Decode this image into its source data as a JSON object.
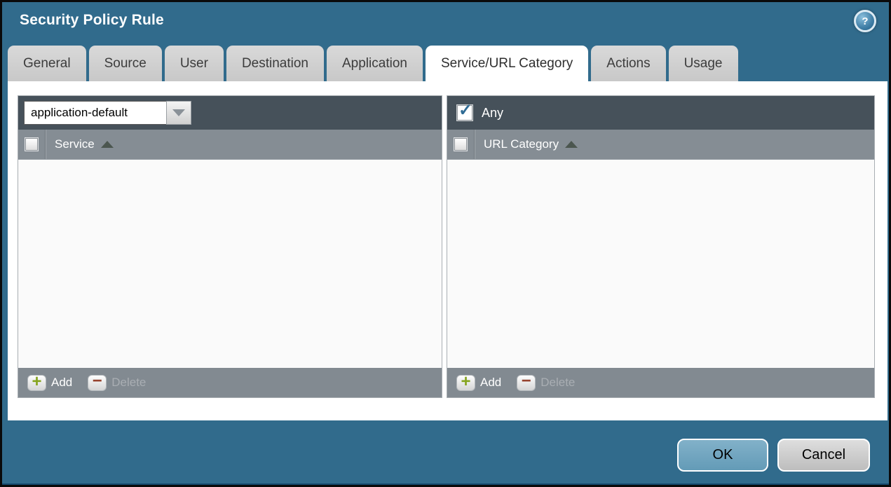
{
  "window": {
    "title": "Security Policy Rule"
  },
  "icons": {
    "question": "?",
    "check": "✓",
    "plus": "+",
    "minus": "−"
  },
  "tabs": [
    {
      "label": "General",
      "active": false
    },
    {
      "label": "Source",
      "active": false
    },
    {
      "label": "User",
      "active": false
    },
    {
      "label": "Destination",
      "active": false
    },
    {
      "label": "Application",
      "active": false
    },
    {
      "label": "Service/URL Category",
      "active": true
    },
    {
      "label": "Actions",
      "active": false
    },
    {
      "label": "Usage",
      "active": false
    }
  ],
  "service_panel": {
    "selected_service_type": "application-default",
    "column_header": "Service",
    "sort": "ascending",
    "add_label": "Add",
    "delete_label": "Delete",
    "delete_enabled": false,
    "rows": []
  },
  "url_category_panel": {
    "any_label": "Any",
    "any_checked": true,
    "column_header": "URL Category",
    "sort": "ascending",
    "add_label": "Add",
    "delete_label": "Delete",
    "delete_enabled": false,
    "rows": []
  },
  "dialog_buttons": {
    "ok_label": "OK",
    "cancel_label": "Cancel"
  },
  "colors": {
    "dialog_teal": "#316b8c",
    "toolbar_dark": "#46515a",
    "header_gray": "#858d94",
    "footer_gray": "#828a91",
    "tab_gray": "#cdcdcd",
    "active_tab_white": "#ffffff",
    "list_background": "#fafafa",
    "ok_button": "#6fa2bc",
    "cancel_button": "#cbcbcb",
    "add_plus_green": "#86a41e",
    "delete_minus_red": "#97432e",
    "checkmark_blue": "#2f6b94"
  }
}
